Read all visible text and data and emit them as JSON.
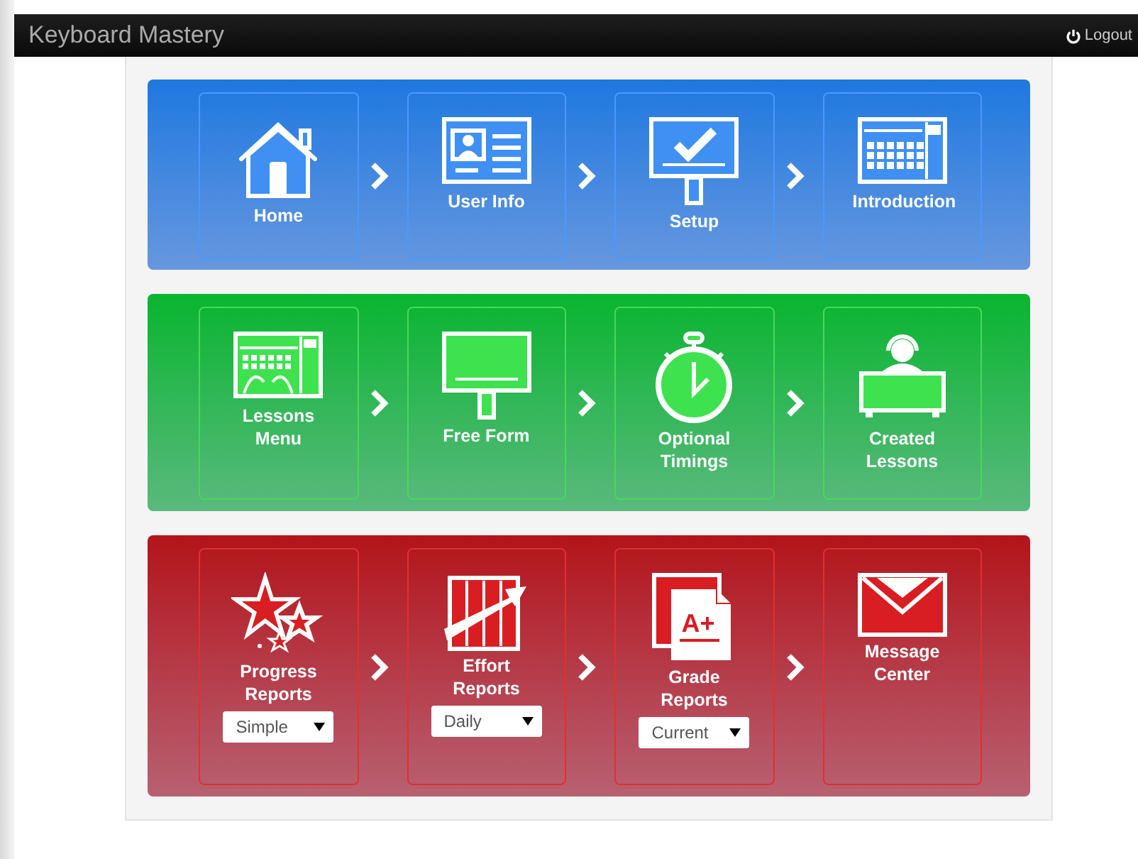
{
  "navbar": {
    "title": "Keyboard Mastery",
    "logout": "Logout"
  },
  "sections": [
    {
      "color": "#1f78e0",
      "tiles": [
        {
          "label": "Home"
        },
        {
          "label": "User Info"
        },
        {
          "label": "Setup"
        },
        {
          "label": "Introduction"
        }
      ]
    },
    {
      "color": "#09b52f",
      "tiles": [
        {
          "label": "Lessons Menu"
        },
        {
          "label": "Free Form"
        },
        {
          "label": "Optional Timings"
        },
        {
          "label": "Created Lessons"
        }
      ]
    },
    {
      "color": "#b3141a",
      "tiles": [
        {
          "label": "Progress Reports",
          "dropdown": "Simple"
        },
        {
          "label": "Effort Reports",
          "dropdown": "Daily"
        },
        {
          "label": "Grade Reports",
          "dropdown": "Current",
          "icon_text": "A+"
        },
        {
          "label": "Message Center"
        }
      ]
    }
  ]
}
